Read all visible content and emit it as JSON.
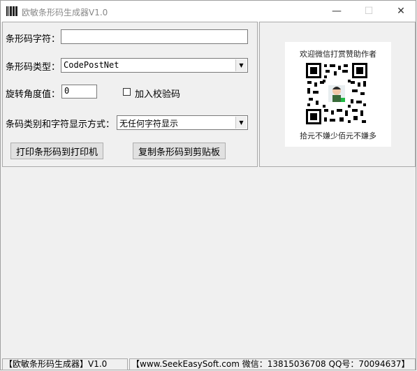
{
  "window": {
    "title": "欧敏条形码生成器V1.0",
    "minimize_glyph": "—",
    "maximize_glyph": "☐",
    "close_glyph": "✕"
  },
  "form": {
    "barcode_text_label": "条形码字符：",
    "barcode_text_value": "",
    "barcode_type_label": "条形码类型：",
    "barcode_type_value": "CodePostNet",
    "rotation_label": "旋转角度值：",
    "rotation_value": "0",
    "checksum_label": "加入校验码",
    "checksum_checked": false,
    "display_mode_label": "条码类别和字符显示方式：",
    "display_mode_value": "无任何字符显示",
    "print_button": "打印条形码到打印机",
    "copy_button": "复制条形码到剪贴板"
  },
  "donate": {
    "top_caption": "欢迎微信打赏赞助作者",
    "bottom_caption": "拾元不嫌少佰元不嫌多"
  },
  "status": {
    "left": "【欧敏条形码生成器】V1.0",
    "right": "【www.SeekEasySoft.com 微信：13815036708 QQ号：70094637】"
  },
  "icons": {
    "app": "barcode-icon",
    "dropdown": "chevron-down-icon"
  }
}
